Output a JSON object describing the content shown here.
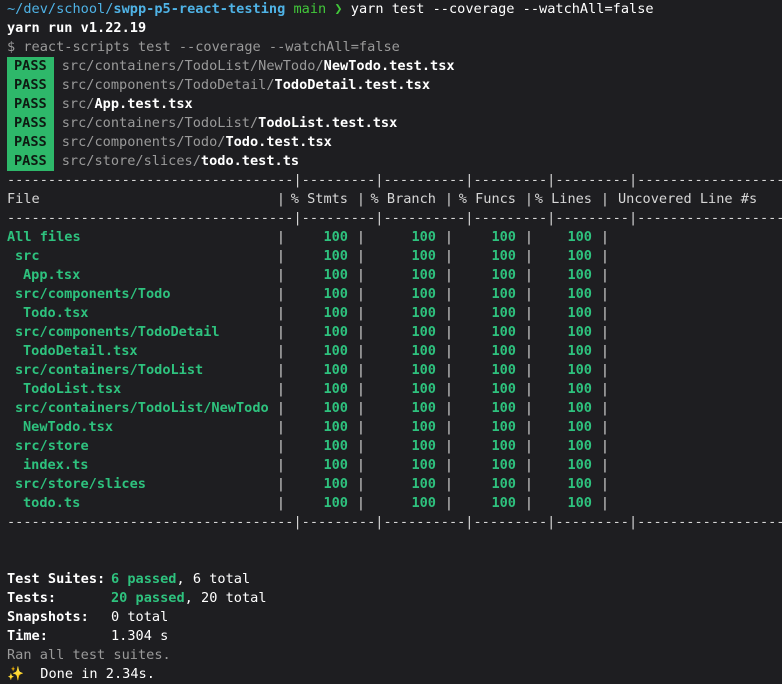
{
  "prompt": {
    "cwd_prefix": "~/dev/school/",
    "cwd_repo": "swpp-p5-react-testing",
    "branch": "main",
    "arrow": "❯",
    "command": "yarn test --coverage --watchAll=false"
  },
  "yarn_line": "yarn run v1.22.19",
  "script_line": "$ react-scripts test --coverage --watchAll=false",
  "pass_label": "PASS",
  "passes": [
    {
      "dir": "src/containers/TodoList/NewTodo/",
      "file": "NewTodo.test.tsx"
    },
    {
      "dir": "src/components/TodoDetail/",
      "file": "TodoDetail.test.tsx"
    },
    {
      "dir": "src/",
      "file": "App.test.tsx"
    },
    {
      "dir": "src/containers/TodoList/",
      "file": "TodoList.test.tsx"
    },
    {
      "dir": "src/components/Todo/",
      "file": "Todo.test.tsx"
    },
    {
      "dir": "src/store/slices/",
      "file": "todo.test.ts"
    }
  ],
  "table": {
    "border_line": "-----------------------------------|---------|----------|---------|---------|-------------------",
    "headers": [
      "File",
      "% Stmts",
      "% Branch",
      "% Funcs",
      "% Lines",
      "Uncovered Line #s"
    ],
    "rows": [
      {
        "name": "All files",
        "indent": 0,
        "values": [
          "100",
          "100",
          "100",
          "100"
        ]
      },
      {
        "name": "src",
        "indent": 1,
        "values": [
          "100",
          "100",
          "100",
          "100"
        ]
      },
      {
        "name": "App.tsx",
        "indent": 2,
        "values": [
          "100",
          "100",
          "100",
          "100"
        ]
      },
      {
        "name": "src/components/Todo",
        "indent": 1,
        "values": [
          "100",
          "100",
          "100",
          "100"
        ]
      },
      {
        "name": "Todo.tsx",
        "indent": 2,
        "values": [
          "100",
          "100",
          "100",
          "100"
        ]
      },
      {
        "name": "src/components/TodoDetail",
        "indent": 1,
        "values": [
          "100",
          "100",
          "100",
          "100"
        ]
      },
      {
        "name": "TodoDetail.tsx",
        "indent": 2,
        "values": [
          "100",
          "100",
          "100",
          "100"
        ]
      },
      {
        "name": "src/containers/TodoList",
        "indent": 1,
        "values": [
          "100",
          "100",
          "100",
          "100"
        ]
      },
      {
        "name": "TodoList.tsx",
        "indent": 2,
        "values": [
          "100",
          "100",
          "100",
          "100"
        ]
      },
      {
        "name": "src/containers/TodoList/NewTodo",
        "indent": 1,
        "values": [
          "100",
          "100",
          "100",
          "100"
        ]
      },
      {
        "name": "NewTodo.tsx",
        "indent": 2,
        "values": [
          "100",
          "100",
          "100",
          "100"
        ]
      },
      {
        "name": "src/store",
        "indent": 1,
        "values": [
          "100",
          "100",
          "100",
          "100"
        ]
      },
      {
        "name": "index.ts",
        "indent": 2,
        "values": [
          "100",
          "100",
          "100",
          "100"
        ]
      },
      {
        "name": "src/store/slices",
        "indent": 1,
        "values": [
          "100",
          "100",
          "100",
          "100"
        ]
      },
      {
        "name": "todo.ts",
        "indent": 2,
        "values": [
          "100",
          "100",
          "100",
          "100"
        ]
      }
    ]
  },
  "summary": {
    "suites_label": "Test Suites:",
    "suites_passed": "6 passed",
    "suites_total": ", 6 total",
    "tests_label": "Tests:",
    "tests_passed": "20 passed",
    "tests_total": ", 20 total",
    "snapshots_label": "Snapshots:",
    "snapshots_value": "0 total",
    "time_label": "Time:",
    "time_value": "1.304 s",
    "ran_all": "Ran all test suites.",
    "done_icon": "✨",
    "done_text": "  Done in 2.34s."
  },
  "colors": {
    "background": "#1e1e21",
    "pass_badge": "#2eb86a",
    "coverage_green": "#2ec27e",
    "path_blue": "#4fb3e6"
  }
}
